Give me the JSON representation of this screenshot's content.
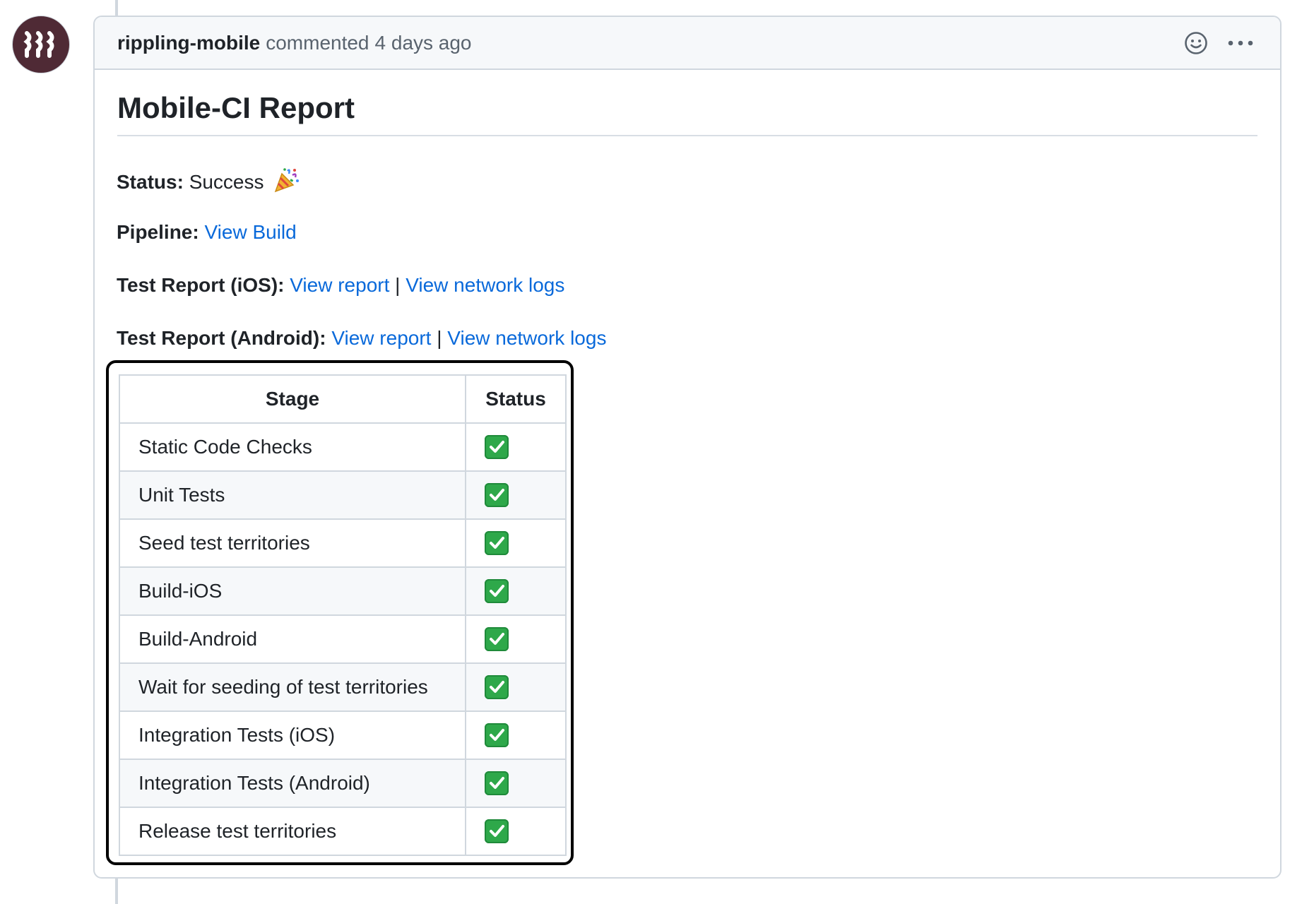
{
  "comment": {
    "author": "rippling-mobile",
    "action": "commented",
    "time": "4 days ago"
  },
  "report": {
    "title": "Mobile-CI Report",
    "status_label": "Status",
    "status_value": "Success",
    "status_icon": "party-popper-icon",
    "pipeline_label": "Pipeline",
    "pipeline_link": "View Build",
    "ios_label": "Test Report (iOS)",
    "ios_report_link": "View report",
    "ios_network_link": "View network logs",
    "android_label": "Test Report (Android)",
    "android_report_link": "View report",
    "android_network_link": "View network logs",
    "separator": "|"
  },
  "table": {
    "headers": [
      "Stage",
      "Status"
    ],
    "rows": [
      {
        "stage": "Static Code Checks",
        "status_icon": "check-mark-button-icon"
      },
      {
        "stage": "Unit Tests",
        "status_icon": "check-mark-button-icon"
      },
      {
        "stage": "Seed test territories",
        "status_icon": "check-mark-button-icon"
      },
      {
        "stage": "Build-iOS",
        "status_icon": "check-mark-button-icon"
      },
      {
        "stage": "Build-Android",
        "status_icon": "check-mark-button-icon"
      },
      {
        "stage": "Wait for seeding of test territories",
        "status_icon": "check-mark-button-icon"
      },
      {
        "stage": "Integration Tests (iOS)",
        "status_icon": "check-mark-button-icon"
      },
      {
        "stage": "Integration Tests (Android)",
        "status_icon": "check-mark-button-icon"
      },
      {
        "stage": "Release test territories",
        "status_icon": "check-mark-button-icon"
      }
    ]
  },
  "colors": {
    "link": "#0969da",
    "avatar_bg": "#4f2a35",
    "check_green": "#2ea84a",
    "highlight_border": "#000000"
  }
}
